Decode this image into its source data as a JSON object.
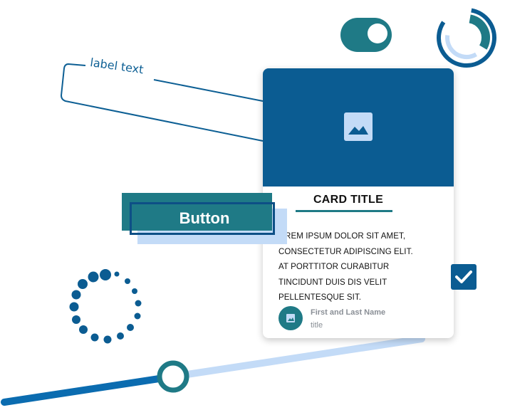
{
  "label": {
    "text": "label text"
  },
  "button": {
    "label": "Button"
  },
  "card": {
    "title": "CARD TITLE",
    "body": "OREM IPSUM DOLOR SIT AMET, CONSECTETUR ADIPISCING ELIT. AT PORTTITOR CURABITUR TINCIDUNT DUIS DIS VELIT PELLENTESQUE SIT.",
    "author_name": "First and Last Name",
    "author_title": "title"
  },
  "toggle": {
    "state": "on"
  },
  "checkbox": {
    "checked": true
  },
  "slider": {
    "value": 0.37
  },
  "colors": {
    "primary": "#0b5c92",
    "teal": "#1f7a86",
    "light_blue": "#c3dbf7",
    "dark_outline": "#0d4f86"
  },
  "icons": {
    "media": "image-icon",
    "avatar": "image-icon",
    "checkbox": "check-icon",
    "loader": "dotted-spinner-icon",
    "progress": "circular-progress-icon"
  }
}
